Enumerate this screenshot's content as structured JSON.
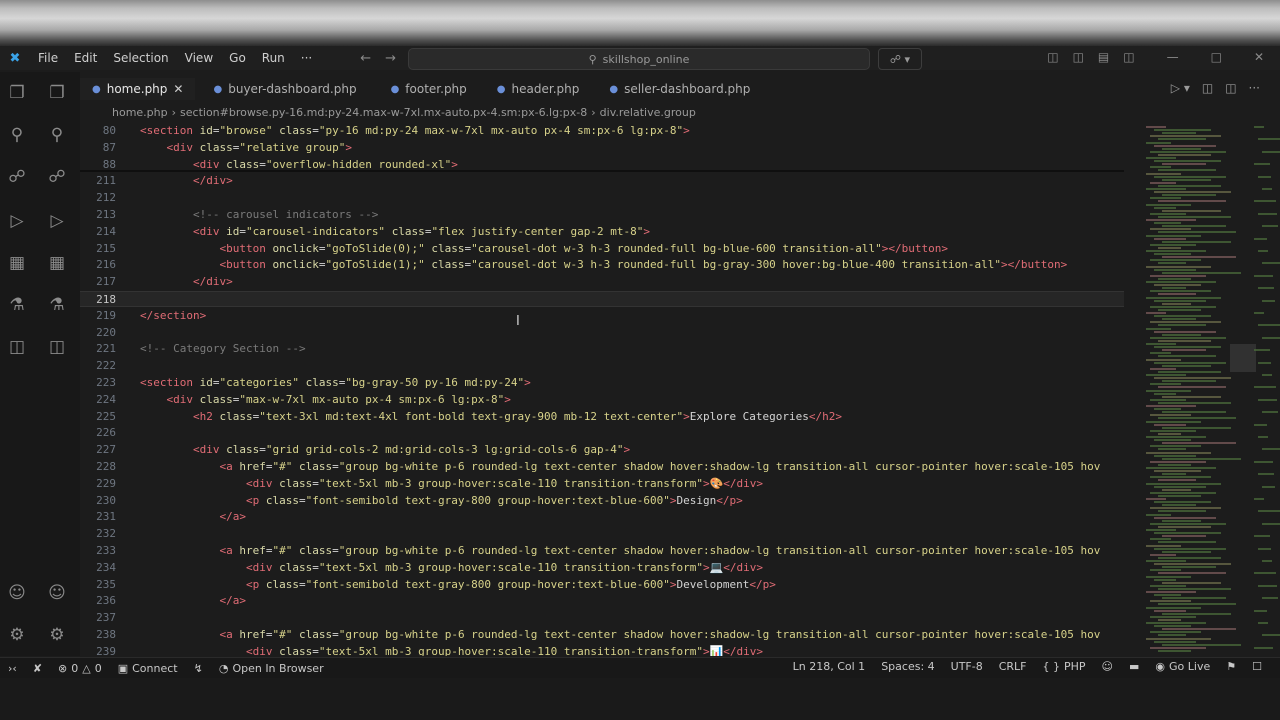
{
  "titlebar": {
    "menu": [
      "File",
      "Edit",
      "Selection",
      "View",
      "Go",
      "Run",
      "···"
    ],
    "search_text": "skillshop_online"
  },
  "tabs": [
    {
      "label": "home.php",
      "active": true
    },
    {
      "label": "buyer-dashboard.php",
      "active": false
    },
    {
      "label": "footer.php",
      "active": false
    },
    {
      "label": "header.php",
      "active": false
    },
    {
      "label": "seller-dashboard.php",
      "active": false
    }
  ],
  "breadcrumb": {
    "file": "home.php",
    "section": "section#browse.py-16.md:py-24.max-w-7xl.mx-auto.px-4.sm:px-6.lg:px-8",
    "div": "div.relative.group"
  },
  "editor": {
    "lines": [
      {
        "n": "80",
        "html": "<span class=\"t\">&lt;section</span> <span class=\"a\">id</span>=<span class=\"s\">\"browse\"</span> <span class=\"a\">class</span>=<span class=\"s\">\"py-16 md:py-24 max-w-7xl mx-auto px-4 sm:px-6 lg:px-8\"</span><span class=\"t\">&gt;</span>"
      },
      {
        "n": "87",
        "html": "    <span class=\"t\">&lt;div</span> <span class=\"a\">class</span>=<span class=\"s\">\"relative group\"</span><span class=\"t\">&gt;</span>"
      },
      {
        "n": "88",
        "html": "        <span class=\"t\">&lt;div</span> <span class=\"a\">class</span>=<span class=\"s\">\"overflow-hidden rounded-xl\"</span><span class=\"t\">&gt;</span>"
      },
      {
        "n": "211",
        "html": "        <span class=\"t\">&lt;/div&gt;</span>"
      },
      {
        "n": "212",
        "html": ""
      },
      {
        "n": "213",
        "html": "        <span class=\"c\">&lt;!-- carousel indicators --&gt;</span>"
      },
      {
        "n": "214",
        "html": "        <span class=\"t\">&lt;div</span> <span class=\"a\">id</span>=<span class=\"s\">\"carousel-indicators\"</span> <span class=\"a\">class</span>=<span class=\"s\">\"flex justify-center gap-2 mt-8\"</span><span class=\"t\">&gt;</span>"
      },
      {
        "n": "215",
        "html": "            <span class=\"t\">&lt;button</span> <span class=\"a\">onclick</span>=<span class=\"s\">\"goToSlide(0);\"</span> <span class=\"a\">class</span>=<span class=\"s\">\"carousel-dot w-3 h-3 rounded-full bg-blue-600 transition-all\"</span><span class=\"t\">&gt;&lt;/button&gt;</span>"
      },
      {
        "n": "216",
        "html": "            <span class=\"t\">&lt;button</span> <span class=\"a\">onclick</span>=<span class=\"s\">\"goToSlide(1);\"</span> <span class=\"a\">class</span>=<span class=\"s\">\"carousel-dot w-3 h-3 rounded-full bg-gray-300 hover:bg-blue-400 transition-all\"</span><span class=\"t\">&gt;&lt;/button&gt;</span>"
      },
      {
        "n": "217",
        "html": "        <span class=\"t\">&lt;/div&gt;</span>"
      },
      {
        "n": "218",
        "html": "",
        "current": true
      },
      {
        "n": "219",
        "html": "<span class=\"t\">&lt;/section&gt;</span>"
      },
      {
        "n": "220",
        "html": ""
      },
      {
        "n": "221",
        "html": "<span class=\"c\">&lt;!-- Category Section --&gt;</span>"
      },
      {
        "n": "222",
        "html": ""
      },
      {
        "n": "223",
        "html": "<span class=\"t\">&lt;section</span> <span class=\"a\">id</span>=<span class=\"s\">\"categories\"</span> <span class=\"a\">class</span>=<span class=\"s\">\"bg-gray-50 py-16 md:py-24\"</span><span class=\"t\">&gt;</span>"
      },
      {
        "n": "224",
        "html": "    <span class=\"t\">&lt;div</span> <span class=\"a\">class</span>=<span class=\"s\">\"max-w-7xl mx-auto px-4 sm:px-6 lg:px-8\"</span><span class=\"t\">&gt;</span>"
      },
      {
        "n": "225",
        "html": "        <span class=\"t\">&lt;h2</span> <span class=\"a\">class</span>=<span class=\"s\">\"text-3xl md:text-4xl font-bold text-gray-900 mb-12 text-center\"</span><span class=\"t\">&gt;</span><span class=\"x\">Explore Categories</span><span class=\"t\">&lt;/h2&gt;</span>"
      },
      {
        "n": "226",
        "html": ""
      },
      {
        "n": "227",
        "html": "        <span class=\"t\">&lt;div</span> <span class=\"a\">class</span>=<span class=\"s\">\"grid grid-cols-2 md:grid-cols-3 lg:grid-cols-6 gap-4\"</span><span class=\"t\">&gt;</span>"
      },
      {
        "n": "228",
        "html": "            <span class=\"t\">&lt;a</span> <span class=\"a\">href</span>=<span class=\"s\">\"#\"</span> <span class=\"a\">class</span>=<span class=\"s\">\"group bg-white p-6 rounded-lg text-center shadow hover:shadow-lg transition-all cursor-pointer hover:scale-105 hov</span>"
      },
      {
        "n": "229",
        "html": "                <span class=\"t\">&lt;div</span> <span class=\"a\">class</span>=<span class=\"s\">\"text-5xl mb-3 group-hover:scale-110 transition-transform\"</span><span class=\"t\">&gt;</span>🎨<span class=\"t\">&lt;/div&gt;</span>"
      },
      {
        "n": "230",
        "html": "                <span class=\"t\">&lt;p</span> <span class=\"a\">class</span>=<span class=\"s\">\"font-semibold text-gray-800 group-hover:text-blue-600\"</span><span class=\"t\">&gt;</span><span class=\"x\">Design</span><span class=\"t\">&lt;/p&gt;</span>"
      },
      {
        "n": "231",
        "html": "            <span class=\"t\">&lt;/a&gt;</span>"
      },
      {
        "n": "232",
        "html": ""
      },
      {
        "n": "233",
        "html": "            <span class=\"t\">&lt;a</span> <span class=\"a\">href</span>=<span class=\"s\">\"#\"</span> <span class=\"a\">class</span>=<span class=\"s\">\"group bg-white p-6 rounded-lg text-center shadow hover:shadow-lg transition-all cursor-pointer hover:scale-105 hov</span>"
      },
      {
        "n": "234",
        "html": "                <span class=\"t\">&lt;div</span> <span class=\"a\">class</span>=<span class=\"s\">\"text-5xl mb-3 group-hover:scale-110 transition-transform\"</span><span class=\"t\">&gt;</span>💻<span class=\"t\">&lt;/div&gt;</span>"
      },
      {
        "n": "235",
        "html": "                <span class=\"t\">&lt;p</span> <span class=\"a\">class</span>=<span class=\"s\">\"font-semibold text-gray-800 group-hover:text-blue-600\"</span><span class=\"t\">&gt;</span><span class=\"x\">Development</span><span class=\"t\">&lt;/p&gt;</span>"
      },
      {
        "n": "236",
        "html": "            <span class=\"t\">&lt;/a&gt;</span>"
      },
      {
        "n": "237",
        "html": ""
      },
      {
        "n": "238",
        "html": "            <span class=\"t\">&lt;a</span> <span class=\"a\">href</span>=<span class=\"s\">\"#\"</span> <span class=\"a\">class</span>=<span class=\"s\">\"group bg-white p-6 rounded-lg text-center shadow hover:shadow-lg transition-all cursor-pointer hover:scale-105 hov</span>"
      },
      {
        "n": "239",
        "html": "                <span class=\"t\">&lt;div</span> <span class=\"a\">class</span>=<span class=\"s\">\"text-5xl mb-3 group-hover:scale-110 transition-transform\"</span><span class=\"t\">&gt;</span>📊<span class=\"t\">&lt;/div&gt;</span>"
      }
    ]
  },
  "statusbar": {
    "errors": "0",
    "warnings": "0",
    "connect": "Connect",
    "open_in_browser": "Open In Browser",
    "position": "Ln 218, Col 1",
    "spaces": "Spaces: 4",
    "encoding": "UTF-8",
    "eol": "CRLF",
    "language": "PHP",
    "go_live": "Go Live"
  },
  "colors": {
    "tag": "#e06c75",
    "attribute": "#d9d9a8",
    "string": "#d7d28a",
    "comment": "#7a7a7a",
    "accent": "#3aa3e8"
  }
}
